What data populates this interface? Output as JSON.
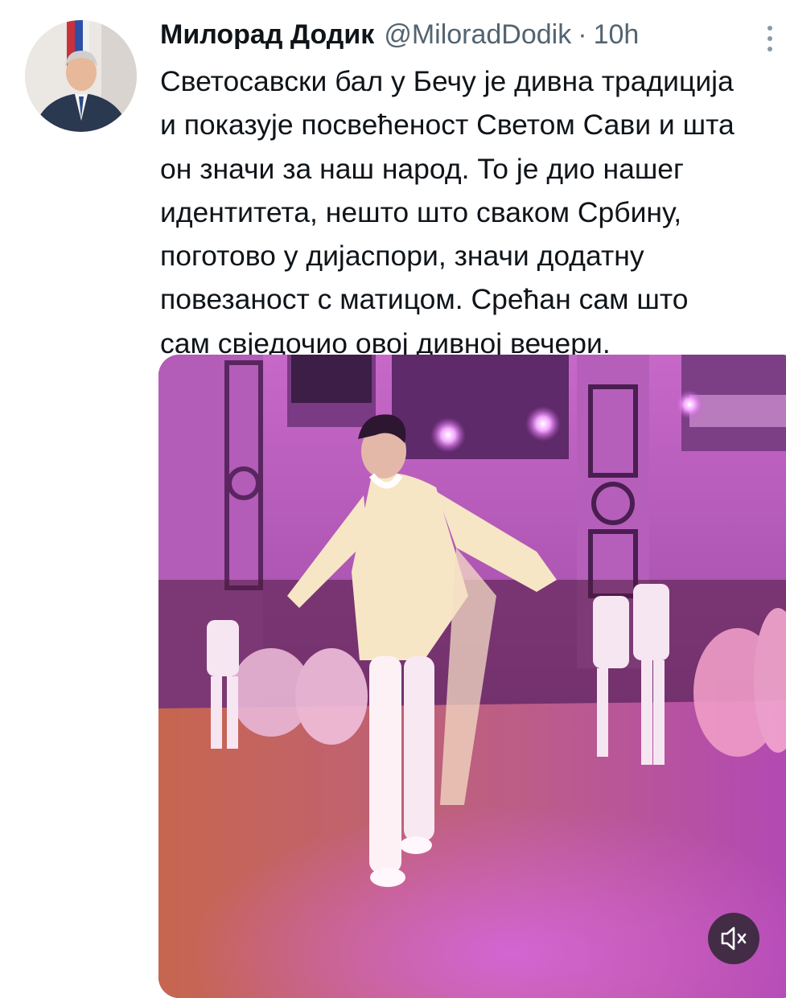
{
  "tweet": {
    "author_name": "Милорад Додик",
    "handle": "@MiloradDodik",
    "separator": "·",
    "time": "10h",
    "text": "Светосавски бал у Бечу је дивна традиција\nи показује посвећеност Светом Сави и шта\nон значи за наш народ. То је дио нашег\nидентитета, нешто што сваком Србину,\nпоготово у дијаспори, значи додатну\nповезаност с матицом. Срећан сам што\nсам свједочио овој дивној вечери."
  },
  "icons": {
    "more": "more-options-icon",
    "mute": "volume-muted-icon"
  },
  "colors": {
    "text": "#0f1419",
    "secondary": "#536471",
    "video_tint": "#b44bb8"
  }
}
